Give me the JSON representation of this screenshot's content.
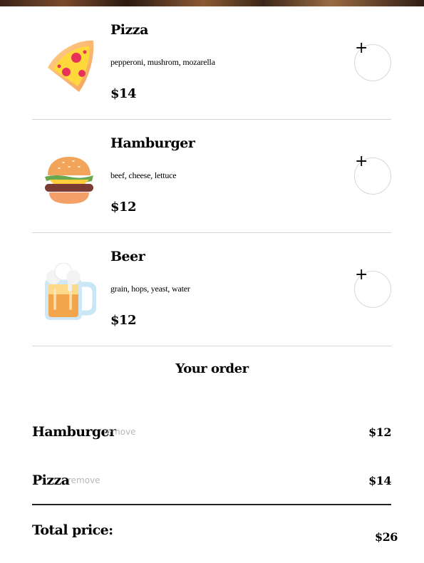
{
  "menu": {
    "items": [
      {
        "name": "Pizza",
        "ingredients": "pepperoni, mushrom, mozarella",
        "price": "$14",
        "icon": "pizza-icon",
        "add_label": "+"
      },
      {
        "name": "Hamburger",
        "ingredients": "beef, cheese, lettuce",
        "price": "$12",
        "icon": "hamburger-icon",
        "add_label": "+"
      },
      {
        "name": "Beer",
        "ingredients": "grain, hops, yeast, water",
        "price": "$12",
        "icon": "beer-icon",
        "add_label": "+"
      }
    ]
  },
  "order": {
    "title": "Your order",
    "items": [
      {
        "name": "Hamburger",
        "remove_label": "remove",
        "price": "$12"
      },
      {
        "name": "Pizza",
        "remove_label": "remove",
        "price": "$14"
      }
    ],
    "total_label": "Total price:",
    "total_price": "$26"
  },
  "colors": {
    "divider": "#d4d4d4",
    "remove_text": "#b8b8b8"
  }
}
